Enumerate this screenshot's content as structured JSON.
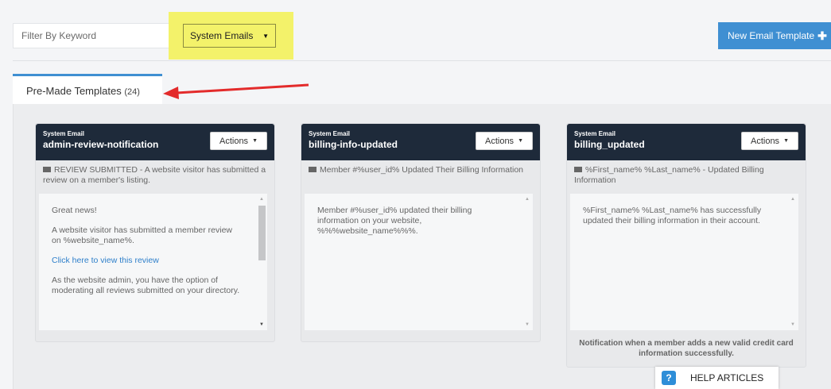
{
  "filter": {
    "placeholder": "Filter By Keyword"
  },
  "select": {
    "value": "System Emails"
  },
  "new_button": {
    "label": "New Email Template"
  },
  "tab": {
    "label": "Pre-Made Templates",
    "count": "(24)"
  },
  "cards": [
    {
      "type": "System Email",
      "title": "admin-review-notification",
      "actions": "Actions",
      "subject": "REVIEW SUBMITTED - A website visitor has submitted a review on a member's listing.",
      "body": [
        "Great news!",
        "A website visitor has submitted a member review on %website_name%.",
        "Click here to view this review",
        "As the website admin, you have the option of moderating all reviews submitted on your directory."
      ]
    },
    {
      "type": "System Email",
      "title": "billing-info-updated",
      "actions": "Actions",
      "subject": "Member #%user_id% Updated Their Billing Information",
      "body": [
        "Member #%user_id% updated their billing information on your website, %%%website_name%%%."
      ]
    },
    {
      "type": "System Email",
      "title": "billing_updated",
      "actions": "Actions",
      "subject": "%First_name% %Last_name% - Updated Billing Information",
      "body": [
        "%First_name% %Last_name% has successfully updated their billing information in their account."
      ],
      "note": "Notification when a member adds a new valid credit card information successfully."
    }
  ],
  "help": {
    "label": "HELP ARTICLES"
  },
  "colors": {
    "accent": "#3f8fd2",
    "card_header": "#1e2a3a",
    "highlight": "#f3f26a",
    "arrow": "#e32b2b"
  }
}
